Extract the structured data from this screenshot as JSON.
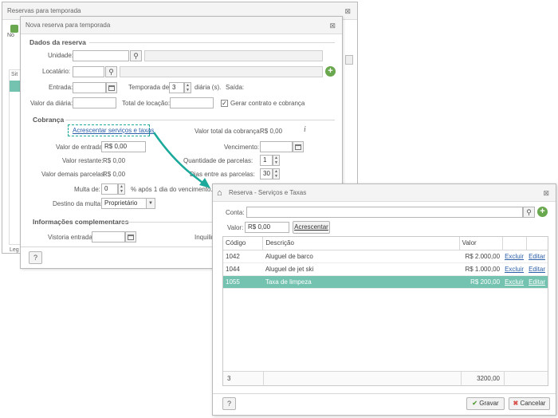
{
  "back_window": {
    "title": "Reservas para temporada",
    "partial_new": "No",
    "partial_sit": "Sit",
    "partial_leg": "Leg"
  },
  "main_window": {
    "title": "Nova reserva para temporada",
    "sections": {
      "dados": "Dados da reserva",
      "cobranca": "Cobrança",
      "informacoes": "Informações complementares"
    },
    "fields": {
      "unidade": "Unidade:",
      "locatario": "Locatário:",
      "entrada": "Entrada:",
      "temporada_de": "Temporada de:",
      "temporada_value": "3",
      "diarias": "diária (s).",
      "saida": "Saída:",
      "valor_diaria": "Valor da diária:",
      "total_locacao": "Total de locação:",
      "gerar_contrato": "Gerar contrato e cobrança",
      "acrescentar_link": "Acrescentar serviços e taxas",
      "valor_total_cobranca": "Valor total da cobrança:",
      "valor_total_cobranca_value": "R$ 0,00",
      "valor_entrada": "Valor de entrada:",
      "valor_entrada_value": "R$ 0,00",
      "vencimento": "Vencimento:",
      "valor_restante": "Valor restante:",
      "valor_restante_value": "R$ 0,00",
      "qtd_parcelas": "Quantidade de parcelas:",
      "qtd_parcelas_value": "1",
      "valor_demais": "Valor demais parcelas:",
      "valor_demais_value": "R$ 0,00",
      "dias_entre": "Dias entre as parcelas:",
      "dias_entre_value": "30",
      "multa_de": "Multa de:",
      "multa_value": "0",
      "multa_suffix": "% após 1 dia do vencimento.",
      "destino_multa": "Destino da multa:",
      "destino_value": "Proprietário",
      "vistoria_entrada": "Vistoria entrada:",
      "inquilino_partial": "Inquilin"
    },
    "help_label": "?"
  },
  "dialog": {
    "title": "Reserva - Serviços e Taxas",
    "conta_label": "Conta:",
    "valor_label": "Valor:",
    "valor_value": "R$ 0,00",
    "acrescentar_button": "Acrescentar",
    "columns": [
      "Código",
      "Descrição",
      "Valor"
    ],
    "rows": [
      {
        "codigo": "1042",
        "descricao": "Aluguel de barco",
        "valor": "R$ 2.000,00",
        "excluir": "Excluir",
        "editar": "Editar",
        "selected": false
      },
      {
        "codigo": "1044",
        "descricao": "Aluguel de jet ski",
        "valor": "R$ 1.000,00",
        "excluir": "Excluir",
        "editar": "Editar",
        "selected": false
      },
      {
        "codigo": "1055",
        "descricao": "Taxa de limpeza",
        "valor": "R$ 200,00",
        "excluir": "Excluir",
        "editar": "Editar",
        "selected": true
      }
    ],
    "footer_count": "3",
    "footer_total": "3200,00",
    "help_label": "?",
    "gravar_button": "Gravar",
    "cancelar_button": "Cancelar"
  },
  "colors": {
    "accent_teal": "#1aa99a",
    "selected_row": "#74c2b0",
    "plus_green": "#6aa84f",
    "cancel_red": "#d9534f"
  }
}
